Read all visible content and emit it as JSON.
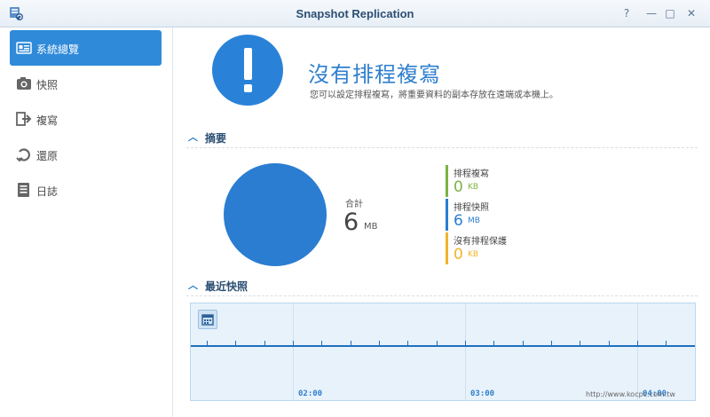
{
  "window": {
    "title": "Snapshot Replication",
    "controls": {
      "help": "?",
      "minimize": "—",
      "maximize": "□",
      "close": "✕"
    }
  },
  "sidebar": {
    "items": [
      {
        "label": "系統總覽",
        "icon": "overview-icon",
        "active": true
      },
      {
        "label": "快照",
        "icon": "camera-icon",
        "active": false
      },
      {
        "label": "複寫",
        "icon": "replication-icon",
        "active": false
      },
      {
        "label": "還原",
        "icon": "restore-icon",
        "active": false
      },
      {
        "label": "日誌",
        "icon": "log-icon",
        "active": false
      }
    ]
  },
  "status": {
    "headline": "沒有排程複寫",
    "description": "您可以設定排程複寫，將重要資料的副本存放在遠端或本機上。"
  },
  "summary": {
    "header": "摘要",
    "total_label": "合計",
    "total_value": "6",
    "total_unit": "MB",
    "items": [
      {
        "name": "排程複寫",
        "value": "0",
        "unit": "KB",
        "color": "#7cb342"
      },
      {
        "name": "排程快照",
        "value": "6",
        "unit": "MB",
        "color": "#2a7dd1"
      },
      {
        "name": "沒有排程保護",
        "value": "0",
        "unit": "KB",
        "color": "#f0b429"
      }
    ]
  },
  "recent": {
    "header": "最近快照",
    "times": [
      "02:00",
      "03:00",
      "04:00"
    ]
  },
  "watermark": {
    "text": "http://www.kocpc.com.tw"
  }
}
